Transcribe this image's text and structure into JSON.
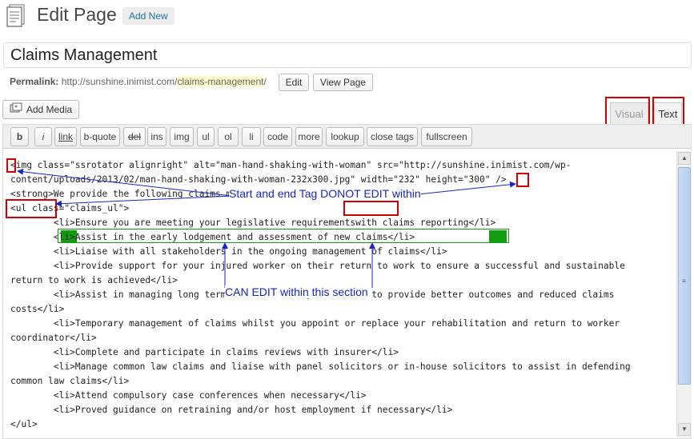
{
  "header": {
    "title": "Edit Page",
    "add_new": "Add New"
  },
  "post": {
    "title": "Claims Management"
  },
  "permalink": {
    "label": "Permalink:",
    "base": "http://sunshine.inimist.com/",
    "slug": "claims-management",
    "trail": "/",
    "edit_label": "Edit",
    "view_label": "View Page"
  },
  "media": {
    "add_media_label": "Add Media"
  },
  "editor_tabs": {
    "visual": "Visual",
    "text": "Text"
  },
  "quicktags": [
    "b",
    "i",
    "link",
    "b-quote",
    "del",
    "ins",
    "img",
    "ul",
    "ol",
    "li",
    "code",
    "more",
    "lookup",
    "close tags",
    "fullscreen"
  ],
  "code_lines": [
    "<img class=\"ssrotator alignright\" alt=\"man-hand-shaking-with-woman\" src=\"http://sunshine.inimist.com/wp-",
    "content/uploads/2013/02/man-hand-shaking-with-woman-232x300.jpg\" width=\"232\" height=\"300\" />",
    "<strong>We provide the following claims management services:</strong>",
    "<ul class=\"claims_ul\">",
    "        <li>Ensure you are meeting your legislative requirementswith claims reporting</li>",
    "        <li>Assist in the early lodgement and assessment of new claims</li>",
    "        <li>Liaise with all stakeholders in the ongoing management of claims</li>",
    "        <li>Provide support for your injured worker on their return to work to ensure a successful and sustainable",
    "return to work is achieved</li>",
    "        <li>Assist in managing long term claims and complex claims to provide better outcomes and reduced claims",
    "costs</li>",
    "        <li>Temporary management of claims whilst you appoint or replace your rehabilitation and return to worker",
    "coordinator</li>",
    "        <li>Complete and participate in claims reviews with insurer</li>",
    "        <li>Manage common law claims and liaise with panel solicitors or in-house solicitors to assist in defending",
    "common law claims</li>",
    "        <li>Attend compulsory case conferences when necessary</li>",
    "        <li>Proved guidance on retraining and/or host employment if necessary</li>",
    "</ul>"
  ],
  "annotations": {
    "do_not_edit": "Start and end Tag DONOT EDIT within",
    "can_edit": "CAN EDIT within this section"
  },
  "colors": {
    "annotation_blue": "#1726c5",
    "highlight_red": "#d40000",
    "highlight_green": "#139c13"
  },
  "icons": {
    "page": "page-icon",
    "media": "media-icon"
  }
}
